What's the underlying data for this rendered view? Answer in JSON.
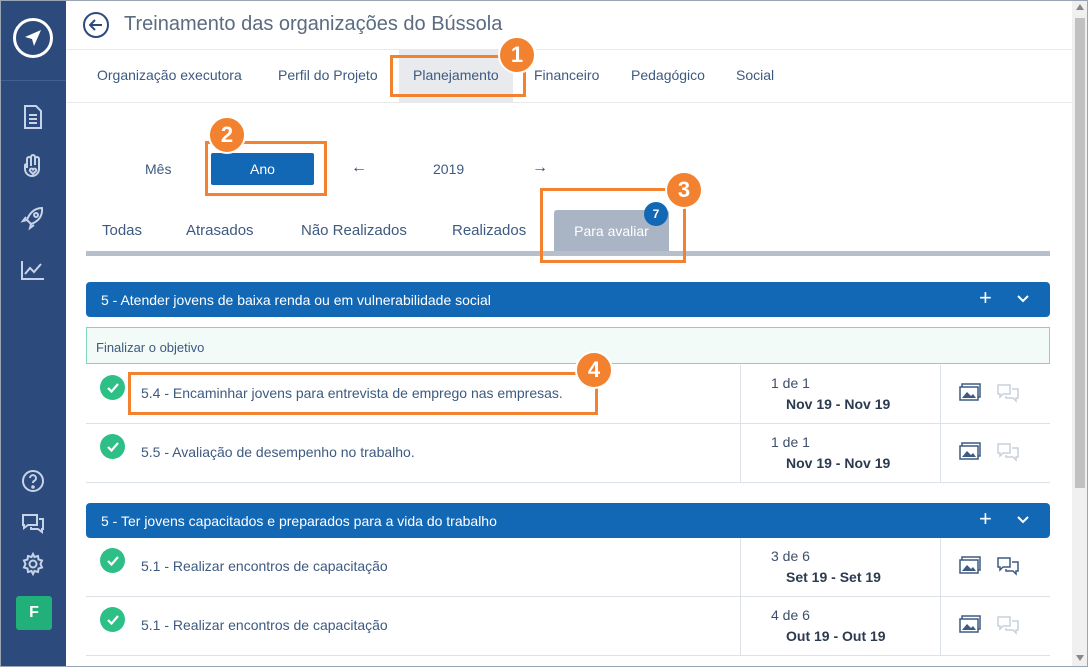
{
  "header": {
    "title": "Treinamento das organizações do Bússola"
  },
  "top_tabs": [
    {
      "label": "Organização executora"
    },
    {
      "label": "Perfil do Projeto"
    },
    {
      "label": "Planejamento"
    },
    {
      "label": "Financeiro"
    },
    {
      "label": "Pedagógico"
    },
    {
      "label": "Social"
    }
  ],
  "period": {
    "month_label": "Mês",
    "year_label": "Ano",
    "year": "2019",
    "prev": "←",
    "next": "→"
  },
  "filter_tabs": [
    {
      "label": "Todas"
    },
    {
      "label": "Atrasados"
    },
    {
      "label": "Não Realizados"
    },
    {
      "label": "Realizados"
    },
    {
      "label": "Para avaliar",
      "badge": "7"
    }
  ],
  "objectives": [
    {
      "title": "5 - Atender jovens de baixa renda ou em vulnerabilidade social",
      "plus": "+",
      "finalize": "Finalizar o objetivo",
      "rows": [
        {
          "label": "5.4 - Encaminhar jovens para entrevista de emprego nas empresas.",
          "count": "1 de 1",
          "date": "Nov 19 - Nov 19"
        },
        {
          "label": "5.5 - Avaliação de desempenho no trabalho.",
          "count": "1 de 1",
          "date": "Nov 19 - Nov 19"
        }
      ]
    },
    {
      "title": "5 - Ter jovens capacitados e preparados para a vida do trabalho",
      "plus": "+",
      "rows": [
        {
          "label": "5.1 - Realizar encontros de capacitação",
          "count": "3 de 6",
          "date": "Set 19 - Set 19"
        },
        {
          "label": "5.1 - Realizar encontros de capacitação",
          "count": "4 de 6",
          "date": "Out 19 - Out 19"
        }
      ]
    }
  ],
  "annotations": [
    "1",
    "2",
    "3",
    "4"
  ],
  "sidebar": {
    "avatar": "F"
  },
  "colors": {
    "sidebar": "#2c4a7c",
    "primary": "#1268b5",
    "success": "#2dbf86",
    "annotation": "#f2822f"
  }
}
